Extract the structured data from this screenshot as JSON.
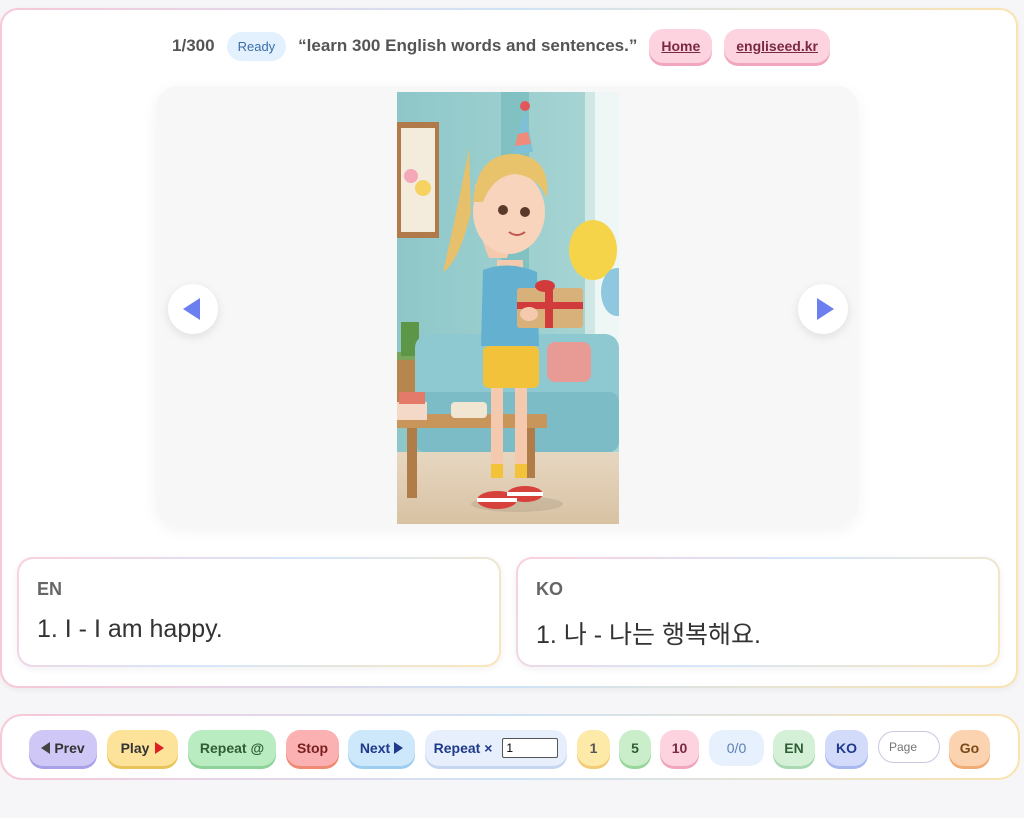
{
  "header": {
    "counter": "1/300",
    "status": "Ready",
    "tagline": "“learn 300 English words and sentences.”",
    "home_label": "Home",
    "site_label": "engliseed.kr"
  },
  "cards": {
    "en_label": "EN",
    "en_text": "1. I - I am happy.",
    "ko_label": "KO",
    "ko_text": "1. 나 - 나는 행복해요."
  },
  "toolbar": {
    "prev_label": "Prev",
    "play_label": "Play",
    "repeat_label": "Repeat @",
    "stop_label": "Stop",
    "next_label": "Next",
    "repeat_x_label": "Repeat ×",
    "repeat_count": "1",
    "speed_1": "1",
    "speed_5": "5",
    "speed_10": "10",
    "progress": "0/0",
    "lang_en": "EN",
    "lang_ko": "KO",
    "page_placeholder": "Page",
    "go_label": "Go"
  },
  "colors": {
    "accent": "#6b7ff0",
    "prev_bg": "#cfc8f6",
    "play_bg": "#fde39a",
    "repeat_bg": "#b9ecc0",
    "stop_bg": "#fbb1b1",
    "next_bg": "#cde8fb"
  }
}
